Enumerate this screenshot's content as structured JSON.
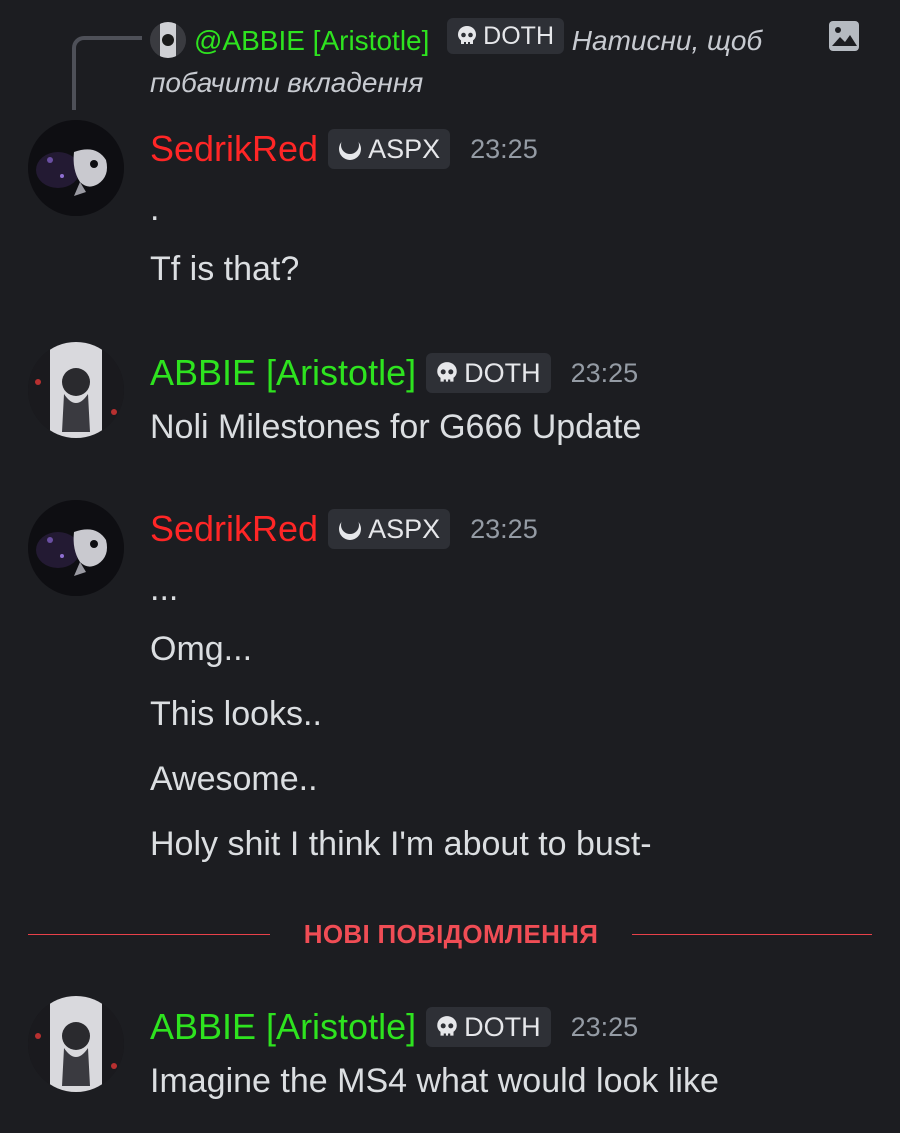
{
  "reply": {
    "author": "@ABBIE [Aristotle]",
    "tag": "DOTH",
    "text": "Натисни, щоб побачити вкладення",
    "icon": "image-icon"
  },
  "messages": [
    {
      "author": "SedrikRed",
      "author_color": "#ff2626",
      "tag": "ASPX",
      "tag_icon": "moon-icon",
      "timestamp": "23:25",
      "lines": [
        ".",
        "Tf is that?"
      ]
    },
    {
      "author": "ABBIE [Aristotle]",
      "author_color": "#2ee31f",
      "tag": "DOTH",
      "tag_icon": "skull-icon",
      "timestamp": "23:25",
      "lines": [
        "Noli Milestones for G666 Update"
      ]
    },
    {
      "author": "SedrikRed",
      "author_color": "#ff2626",
      "tag": "ASPX",
      "tag_icon": "moon-icon",
      "timestamp": "23:25",
      "lines": [
        "...",
        "Omg...",
        "This looks..",
        "Awesome..",
        "Holy shit I think I'm about to bust-"
      ]
    },
    {
      "author": "ABBIE [Aristotle]",
      "author_color": "#2ee31f",
      "tag": "DOTH",
      "tag_icon": "skull-icon",
      "timestamp": "23:25",
      "lines": [
        "Imagine the MS4 what would look like"
      ]
    }
  ],
  "divider": {
    "label": "НОВІ ПОВІДОМЛЕННЯ",
    "color": "#e8414a"
  }
}
